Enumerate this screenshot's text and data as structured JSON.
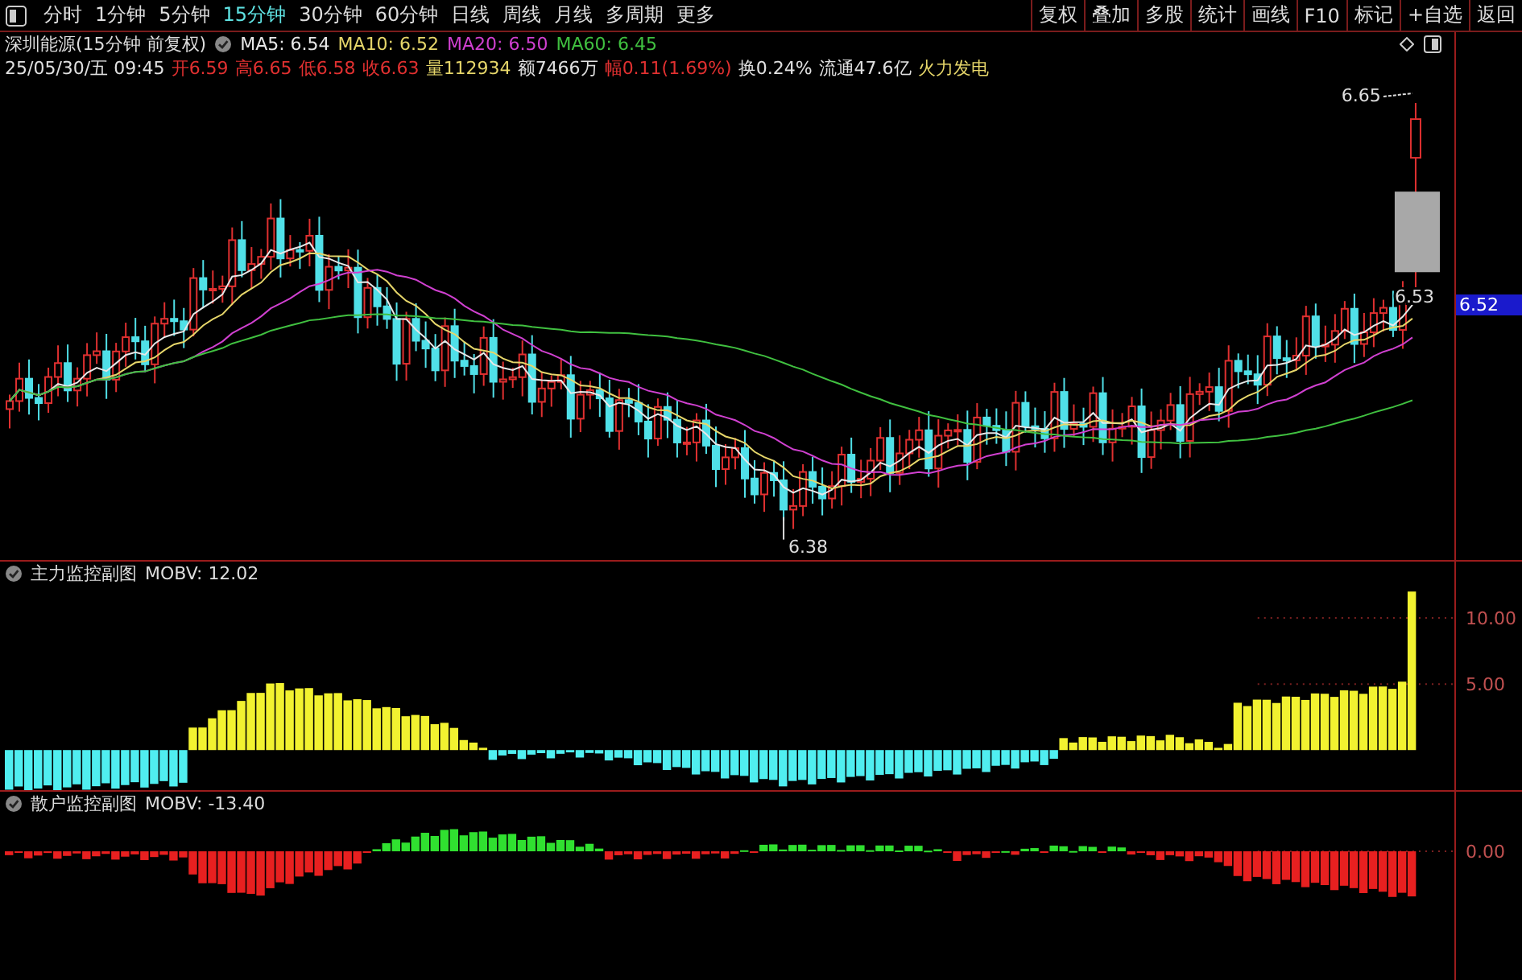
{
  "toolbar": {
    "periods": [
      {
        "label": "分时",
        "selected": false
      },
      {
        "label": "1分钟",
        "selected": false
      },
      {
        "label": "5分钟",
        "selected": false
      },
      {
        "label": "15分钟",
        "selected": true
      },
      {
        "label": "30分钟",
        "selected": false
      },
      {
        "label": "60分钟",
        "selected": false
      },
      {
        "label": "日线",
        "selected": false
      },
      {
        "label": "周线",
        "selected": false
      },
      {
        "label": "月线",
        "selected": false
      },
      {
        "label": "多周期",
        "selected": false
      },
      {
        "label": "更多",
        "selected": false
      }
    ],
    "buttons": [
      "复权",
      "叠加",
      "多股",
      "统计",
      "画线",
      "F10",
      "标记",
      "+自选",
      "返回"
    ]
  },
  "main_chart": {
    "title": "深圳能源(15分钟 前复权)",
    "moving_averages": [
      {
        "label": "MA5: 6.54",
        "color": "#e8e8e8"
      },
      {
        "label": "MA10: 6.52",
        "color": "#e6d66a"
      },
      {
        "label": "MA20: 6.50",
        "color": "#d040d0"
      },
      {
        "label": "MA60: 6.45",
        "color": "#40c040"
      }
    ],
    "quote": [
      {
        "text": "25/05/30/五 09:45",
        "color": "#e0e0e0"
      },
      {
        "text": "开6.59",
        "color": "#e03030"
      },
      {
        "text": "高6.65",
        "color": "#e03030"
      },
      {
        "text": "低6.58",
        "color": "#e03030"
      },
      {
        "text": "收6.63",
        "color": "#e03030"
      },
      {
        "text": "量112934",
        "color": "#e6d66a"
      },
      {
        "text": "额7466万",
        "color": "#e0e0e0"
      },
      {
        "text": "幅0.11(1.69%)",
        "color": "#e03030"
      },
      {
        "text": "换0.24%",
        "color": "#e0e0e0"
      },
      {
        "text": "流通47.6亿",
        "color": "#e0e0e0"
      },
      {
        "text": "火力发电",
        "color": "#e6d66a"
      }
    ],
    "annotations": [
      {
        "kind": "high",
        "text": "6.65"
      },
      {
        "kind": "low",
        "text": "6.38"
      },
      {
        "kind": "last",
        "text": "6.53"
      }
    ],
    "price_tag": "6.52"
  },
  "sub_charts": [
    {
      "title": "主力监控副图",
      "indicator": "MOBV: 12.02",
      "kind": "main_force",
      "ticks": [
        "10.00",
        "5.00"
      ]
    },
    {
      "title": "散户监控副图",
      "indicator": "MOBV: -13.40",
      "kind": "retail",
      "ticks": [
        "0.00"
      ]
    }
  ]
}
